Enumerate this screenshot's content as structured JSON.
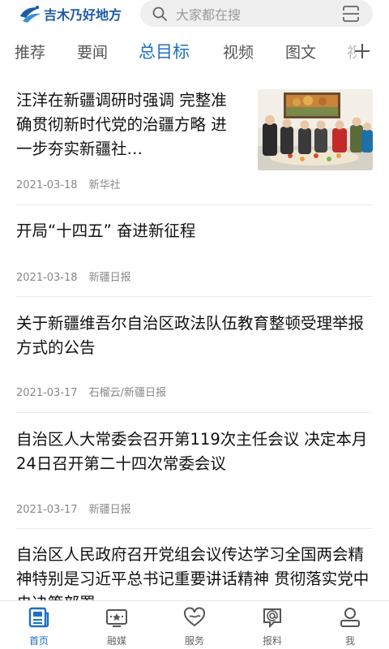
{
  "header": {
    "logo_text": "吉木乃好地方",
    "search_placeholder": "大家都在搜"
  },
  "tabs": [
    {
      "label": "推荐"
    },
    {
      "label": "要闻"
    },
    {
      "label": "总目标",
      "active": true
    },
    {
      "label": "视频"
    },
    {
      "label": "图文"
    },
    {
      "label": "视"
    }
  ],
  "feed": {
    "articles": [
      {
        "title": "汪洋在新疆调研时强调 完整准确贯彻新时代党的治疆方略 进一步夯实新疆社…",
        "date": "2021-03-18",
        "source": "新华社",
        "has_image": true
      },
      {
        "title": "开局“十四五” 奋进新征程",
        "date": "2021-03-18",
        "source": "新疆日报"
      },
      {
        "title": "关于新疆维吾尔自治区政法队伍教育整顿受理举报方式的公告",
        "date": "2021-03-17",
        "source": "石榴云/新疆日报"
      },
      {
        "title": "自治区人大常委会召开第119次主任会议 决定本月24日召开第二十四次常委会议",
        "date": "2021-03-17",
        "source": "新疆日报"
      },
      {
        "title": "自治区人民政府召开党组会议传达学习全国两会精神特别是习近平总书记重要讲话精神 贯彻落实党中央决策部署",
        "date": "",
        "source": ""
      }
    ]
  },
  "bottom_nav": {
    "items": [
      {
        "label": "首页",
        "icon": "news-icon",
        "active": true
      },
      {
        "label": "融媒",
        "icon": "tv-icon"
      },
      {
        "label": "服务",
        "icon": "heart-icon"
      },
      {
        "label": "报料",
        "icon": "at-icon"
      },
      {
        "label": "我",
        "icon": "user-icon"
      }
    ]
  },
  "colors": {
    "accent": "#1d6fc4",
    "logo": "#1d5aa8",
    "search_bg": "#efefef"
  }
}
